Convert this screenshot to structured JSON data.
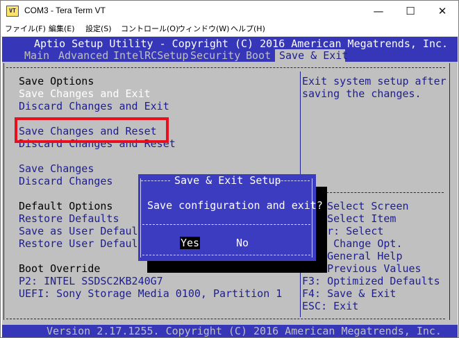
{
  "window": {
    "app_icon": "VT",
    "title": "COM3 - Tera Term VT",
    "min_glyph": "—",
    "max_glyph": "☐",
    "close_glyph": "✕"
  },
  "menubar": {
    "items": [
      "ファイル(F)",
      "編集(E)",
      "設定(S)",
      "コントロール(O)",
      "ウィンドウ(W)",
      "ヘルプ(H)"
    ]
  },
  "bios": {
    "title": "Aptio Setup Utility - Copyright (C) 2016 American Megatrends, Inc.",
    "tabs": [
      "Main",
      "Advanced",
      "IntelRCSetup",
      "Security",
      "Boot",
      "Save & Exit"
    ],
    "active_tab": "Save & Exit",
    "left_items": [
      {
        "label": "Save Options",
        "kind": "heading"
      },
      {
        "label": "Save Changes and Exit",
        "kind": "selected"
      },
      {
        "label": "Discard Changes and Exit",
        "kind": "option"
      },
      {
        "label": "Save Changes and Reset",
        "kind": "option"
      },
      {
        "label": "Discard Changes and Reset",
        "kind": "option"
      },
      {
        "label": "Save Changes",
        "kind": "option"
      },
      {
        "label": "Discard Changes",
        "kind": "option"
      },
      {
        "label": "Default Options",
        "kind": "heading"
      },
      {
        "label": "Restore Defaults",
        "kind": "option"
      },
      {
        "label": "Save as User Defaults",
        "kind": "option"
      },
      {
        "label": "Restore User Defaults",
        "kind": "option"
      },
      {
        "label": "Boot Override",
        "kind": "heading"
      },
      {
        "label": "P2: INTEL SSDSC2KB240G7",
        "kind": "option"
      },
      {
        "label": "UEFI: Sony Storage Media 0100, Partition 1",
        "kind": "option"
      }
    ],
    "help_text": [
      "Exit system setup after",
      "saving the changes."
    ],
    "keys": [
      "→←: Select Screen",
      "↑↓: Select Item",
      "Enter: Select",
      "+/-: Change Opt.",
      "F1: General Help",
      "F2: Previous Values",
      "F3: Optimized Defaults",
      "F4: Save & Exit",
      "ESC: Exit"
    ],
    "footer": "Version 2.17.1255. Copyright (C) 2016 American Megatrends, Inc."
  },
  "dialog": {
    "title": "Save & Exit Setup",
    "question": "Save configuration and exit?",
    "yes_label": "Yes",
    "no_label": "No",
    "selected": "Yes"
  },
  "colors": {
    "bios_blue": "#3636b8",
    "bios_grey": "#c0c0c0",
    "option_text": "#1d1d8f",
    "highlight_text": "#ffffff",
    "annotation_red": "#e8101e"
  }
}
